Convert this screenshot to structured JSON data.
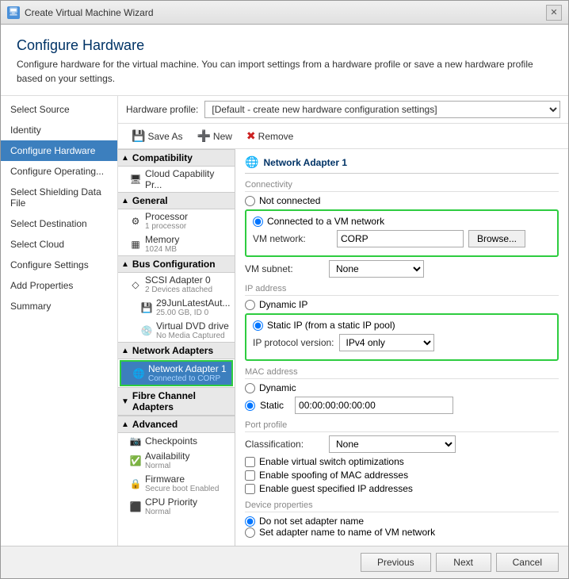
{
  "window": {
    "title": "Create Virtual Machine Wizard",
    "close_label": "✕"
  },
  "header": {
    "title": "Configure Hardware",
    "description": "Configure hardware for the virtual machine. You can import settings from a hardware profile or save a new hardware profile based on your settings."
  },
  "hardware_profile": {
    "label": "Hardware profile:",
    "value": "[Default - create new hardware configuration settings]"
  },
  "toolbar": {
    "save_as": "Save As",
    "new": "New",
    "remove": "Remove"
  },
  "sidebar": {
    "items": [
      {
        "label": "Select Source",
        "active": false
      },
      {
        "label": "Identity",
        "active": false
      },
      {
        "label": "Configure Hardware",
        "active": true
      },
      {
        "label": "Configure Operating...",
        "active": false
      },
      {
        "label": "Select Shielding Data File",
        "active": false
      },
      {
        "label": "Select Destination",
        "active": false
      },
      {
        "label": "Select Cloud",
        "active": false
      },
      {
        "label": "Configure Settings",
        "active": false
      },
      {
        "label": "Add Properties",
        "active": false
      },
      {
        "label": "Summary",
        "active": false
      }
    ]
  },
  "tree": {
    "compatibility": {
      "header": "Compatibility",
      "items": [
        {
          "label": "Cloud Capability Pr...",
          "icon": "🖥"
        }
      ]
    },
    "general": {
      "header": "General",
      "items": [
        {
          "label": "Processor",
          "sub": "1 processor",
          "icon": "⚙"
        },
        {
          "label": "Memory",
          "sub": "1024 MB",
          "icon": "▦"
        }
      ]
    },
    "bus_config": {
      "header": "Bus Configuration",
      "items": [
        {
          "label": "SCSI Adapter 0",
          "sub": "2 Devices attached",
          "icon": "◇"
        },
        {
          "label": "29JunLatestAut...",
          "sub": "25.00 GB, ID 0",
          "icon": "💾",
          "indent": true
        },
        {
          "label": "Virtual DVD drive",
          "sub": "No Media Captured",
          "icon": "💿",
          "indent": true
        }
      ]
    },
    "network_adapters": {
      "header": "Network Adapters",
      "items": [
        {
          "label": "Network Adapter 1",
          "sub": "Connected to CORP",
          "icon": "🌐",
          "selected": true
        }
      ]
    },
    "fibre": {
      "header": "Fibre Channel Adapters"
    },
    "advanced": {
      "header": "Advanced",
      "items": [
        {
          "label": "Checkpoints",
          "icon": "📷"
        },
        {
          "label": "Availability",
          "sub": "Normal",
          "icon": "✅"
        },
        {
          "label": "Firmware",
          "sub": "Secure boot Enabled",
          "icon": "🔒"
        },
        {
          "label": "CPU Priority",
          "sub": "Normal",
          "icon": "⬛"
        }
      ]
    }
  },
  "right_panel": {
    "title": "Network Adapter 1",
    "connectivity": {
      "header": "Connectivity",
      "not_connected_label": "Not connected",
      "connected_vm_label": "Connected to a VM network",
      "vm_network_label": "VM network:",
      "vm_network_value": "CORP",
      "browse_label": "Browse...",
      "vm_subnet_label": "VM subnet:",
      "vm_subnet_value": "None"
    },
    "ip_address": {
      "header": "IP address",
      "dynamic_label": "Dynamic IP",
      "static_label": "Static IP (from a static IP pool)",
      "protocol_label": "IP protocol version:",
      "protocol_value": "IPv4 only"
    },
    "mac_address": {
      "header": "MAC address",
      "dynamic_label": "Dynamic",
      "static_label": "Static",
      "static_value": "00:00:00:00:00:00"
    },
    "port_profile": {
      "header": "Port profile",
      "classification_label": "Classification:",
      "classification_value": "None"
    },
    "checkboxes": {
      "opt1": "Enable virtual switch optimizations",
      "opt2": "Enable spoofing of MAC addresses",
      "opt3": "Enable guest specified IP addresses"
    },
    "device_props": {
      "header": "Device properties",
      "opt1": "Do not set adapter name",
      "opt2": "Set adapter name to name of VM network"
    }
  },
  "footer": {
    "previous_label": "Previous",
    "next_label": "Next",
    "cancel_label": "Cancel"
  }
}
